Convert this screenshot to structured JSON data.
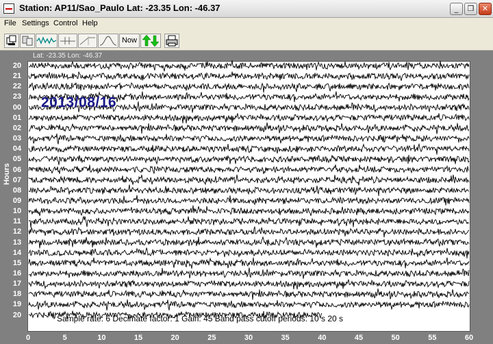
{
  "window": {
    "title": "Station: AP11/Sao_Paulo  Lat: -23.35  Lon: -46.37",
    "minimize_glyph": "_",
    "maximize_glyph": "❐",
    "close_glyph": "✕"
  },
  "menu": {
    "items": [
      "File",
      "Settings",
      "Control",
      "Help"
    ]
  },
  "toolbar": {
    "now_label": "Now",
    "icons": [
      "copy-window-icon",
      "copy-data-icon",
      "waveform-icon",
      "filter-icon",
      "lowpass-icon",
      "bandpass-icon",
      "up-down-arrows-icon",
      "printer-icon"
    ]
  },
  "plot": {
    "latlon": "Lat: -23.35  Lon: -46.37",
    "date": "2013/08/16",
    "y_axis_title": "Hours",
    "hour_labels": [
      "20",
      "21",
      "22",
      "23",
      "00",
      "01",
      "02",
      "03",
      "04",
      "05",
      "06",
      "07",
      "08",
      "09",
      "10",
      "11",
      "12",
      "13",
      "14",
      "15",
      "16",
      "17",
      "18",
      "19",
      "20"
    ],
    "x_ticks": [
      "0",
      "5",
      "10",
      "15",
      "20",
      "25",
      "30",
      "35",
      "40",
      "45",
      "50",
      "55",
      "60"
    ],
    "info": "Sample rate: 6   Decimate factor: 1   Gain: 45   Band pass cutoff periods: 10 s  20 s",
    "trace_color": "#000000",
    "last_trace_end_minute": 40
  }
}
